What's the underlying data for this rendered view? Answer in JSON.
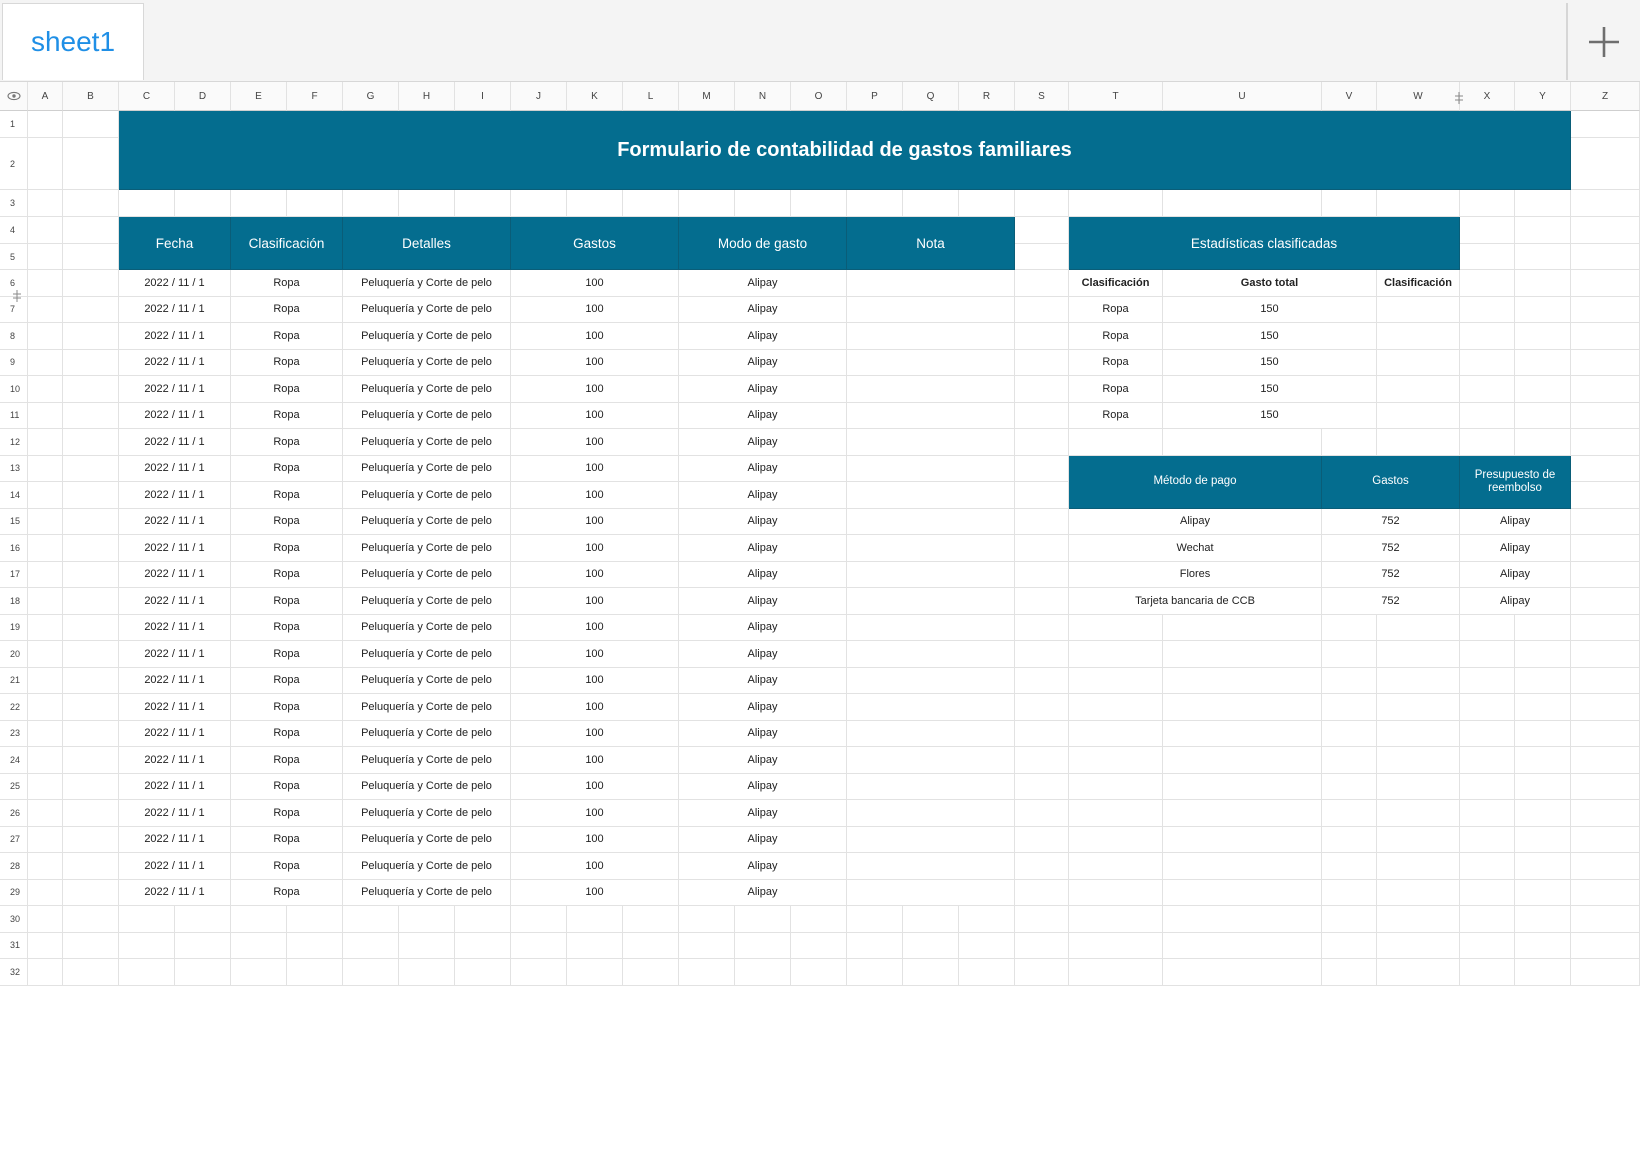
{
  "tabs": {
    "sheet_name": "sheet1"
  },
  "columns": [
    "A",
    "B",
    "C",
    "D",
    "E",
    "F",
    "G",
    "H",
    "I",
    "J",
    "K",
    "L",
    "M",
    "N",
    "O",
    "P",
    "Q",
    "R",
    "S",
    "T",
    "U",
    "V",
    "W",
    "X",
    "Y",
    "Z"
  ],
  "rows": [
    "1",
    "2",
    "3",
    "4",
    "5",
    "6",
    "7",
    "8",
    "9",
    "10",
    "11",
    "12",
    "13",
    "14",
    "15",
    "16",
    "17",
    "18",
    "19",
    "20",
    "21",
    "22",
    "23",
    "24",
    "25",
    "26",
    "27",
    "28",
    "29",
    "30",
    "31",
    "32"
  ],
  "title": "Formulario de contabilidad de gastos familiares",
  "main_table": {
    "headers": [
      "Fecha",
      "Clasificación",
      "Detalles",
      "Gastos",
      "Modo de gasto",
      "Nota"
    ],
    "rows": [
      {
        "fecha": "2022 / 11 / 1",
        "clasificacion": "Ropa",
        "detalles": "Peluquería y Corte de pelo",
        "gastos": "100",
        "modo": "Alipay",
        "nota": ""
      },
      {
        "fecha": "2022 / 11 / 1",
        "clasificacion": "Ropa",
        "detalles": "Peluquería y Corte de pelo",
        "gastos": "100",
        "modo": "Alipay",
        "nota": ""
      },
      {
        "fecha": "2022 / 11 / 1",
        "clasificacion": "Ropa",
        "detalles": "Peluquería y Corte de pelo",
        "gastos": "100",
        "modo": "Alipay",
        "nota": ""
      },
      {
        "fecha": "2022 / 11 / 1",
        "clasificacion": "Ropa",
        "detalles": "Peluquería y Corte de pelo",
        "gastos": "100",
        "modo": "Alipay",
        "nota": ""
      },
      {
        "fecha": "2022 / 11 / 1",
        "clasificacion": "Ropa",
        "detalles": "Peluquería y Corte de pelo",
        "gastos": "100",
        "modo": "Alipay",
        "nota": ""
      },
      {
        "fecha": "2022 / 11 / 1",
        "clasificacion": "Ropa",
        "detalles": "Peluquería y Corte de pelo",
        "gastos": "100",
        "modo": "Alipay",
        "nota": ""
      },
      {
        "fecha": "2022 / 11 / 1",
        "clasificacion": "Ropa",
        "detalles": "Peluquería y Corte de pelo",
        "gastos": "100",
        "modo": "Alipay",
        "nota": ""
      },
      {
        "fecha": "2022 / 11 / 1",
        "clasificacion": "Ropa",
        "detalles": "Peluquería y Corte de pelo",
        "gastos": "100",
        "modo": "Alipay",
        "nota": ""
      },
      {
        "fecha": "2022 / 11 / 1",
        "clasificacion": "Ropa",
        "detalles": "Peluquería y Corte de pelo",
        "gastos": "100",
        "modo": "Alipay",
        "nota": ""
      },
      {
        "fecha": "2022 / 11 / 1",
        "clasificacion": "Ropa",
        "detalles": "Peluquería y Corte de pelo",
        "gastos": "100",
        "modo": "Alipay",
        "nota": ""
      },
      {
        "fecha": "2022 / 11 / 1",
        "clasificacion": "Ropa",
        "detalles": "Peluquería y Corte de pelo",
        "gastos": "100",
        "modo": "Alipay",
        "nota": ""
      },
      {
        "fecha": "2022 / 11 / 1",
        "clasificacion": "Ropa",
        "detalles": "Peluquería y Corte de pelo",
        "gastos": "100",
        "modo": "Alipay",
        "nota": ""
      },
      {
        "fecha": "2022 / 11 / 1",
        "clasificacion": "Ropa",
        "detalles": "Peluquería y Corte de pelo",
        "gastos": "100",
        "modo": "Alipay",
        "nota": ""
      },
      {
        "fecha": "2022 / 11 / 1",
        "clasificacion": "Ropa",
        "detalles": "Peluquería y Corte de pelo",
        "gastos": "100",
        "modo": "Alipay",
        "nota": ""
      },
      {
        "fecha": "2022 / 11 / 1",
        "clasificacion": "Ropa",
        "detalles": "Peluquería y Corte de pelo",
        "gastos": "100",
        "modo": "Alipay",
        "nota": ""
      },
      {
        "fecha": "2022 / 11 / 1",
        "clasificacion": "Ropa",
        "detalles": "Peluquería y Corte de pelo",
        "gastos": "100",
        "modo": "Alipay",
        "nota": ""
      },
      {
        "fecha": "2022 / 11 / 1",
        "clasificacion": "Ropa",
        "detalles": "Peluquería y Corte de pelo",
        "gastos": "100",
        "modo": "Alipay",
        "nota": ""
      },
      {
        "fecha": "2022 / 11 / 1",
        "clasificacion": "Ropa",
        "detalles": "Peluquería y Corte de pelo",
        "gastos": "100",
        "modo": "Alipay",
        "nota": ""
      },
      {
        "fecha": "2022 / 11 / 1",
        "clasificacion": "Ropa",
        "detalles": "Peluquería y Corte de pelo",
        "gastos": "100",
        "modo": "Alipay",
        "nota": ""
      },
      {
        "fecha": "2022 / 11 / 1",
        "clasificacion": "Ropa",
        "detalles": "Peluquería y Corte de pelo",
        "gastos": "100",
        "modo": "Alipay",
        "nota": ""
      },
      {
        "fecha": "2022 / 11 / 1",
        "clasificacion": "Ropa",
        "detalles": "Peluquería y Corte de pelo",
        "gastos": "100",
        "modo": "Alipay",
        "nota": ""
      },
      {
        "fecha": "2022 / 11 / 1",
        "clasificacion": "Ropa",
        "detalles": "Peluquería y Corte de pelo",
        "gastos": "100",
        "modo": "Alipay",
        "nota": ""
      },
      {
        "fecha": "2022 / 11 / 1",
        "clasificacion": "Ropa",
        "detalles": "Peluquería y Corte de pelo",
        "gastos": "100",
        "modo": "Alipay",
        "nota": ""
      },
      {
        "fecha": "2022 / 11 / 1",
        "clasificacion": "Ropa",
        "detalles": "Peluquería y Corte de pelo",
        "gastos": "100",
        "modo": "Alipay",
        "nota": ""
      }
    ]
  },
  "stats_table": {
    "title": "Estadísticas clasificadas",
    "headers": [
      "Clasificación",
      "Gasto total",
      "Clasificación"
    ],
    "rows": [
      {
        "clasificacion": "Ropa",
        "gasto_total": "150",
        "extra": ""
      },
      {
        "clasificacion": "Ropa",
        "gasto_total": "150",
        "extra": ""
      },
      {
        "clasificacion": "Ropa",
        "gasto_total": "150",
        "extra": ""
      },
      {
        "clasificacion": "Ropa",
        "gasto_total": "150",
        "extra": ""
      },
      {
        "clasificacion": "Ropa",
        "gasto_total": "150",
        "extra": ""
      }
    ]
  },
  "payment_table": {
    "headers": [
      "Método de pago",
      "Gastos",
      "Presupuesto de reembolso"
    ],
    "rows": [
      {
        "metodo": "Alipay",
        "gastos": "752",
        "presupuesto": "Alipay"
      },
      {
        "metodo": "Wechat",
        "gastos": "752",
        "presupuesto": "Alipay"
      },
      {
        "metodo": "Flores",
        "gastos": "752",
        "presupuesto": "Alipay"
      },
      {
        "metodo": "Tarjeta bancaria de CCB",
        "gastos": "752",
        "presupuesto": "Alipay"
      }
    ]
  },
  "colors": {
    "accent": "#046d8f",
    "tab_text": "#1f8fe6",
    "grid_line": "#e2e2e2"
  },
  "icons": {
    "add_sheet": "plus-icon",
    "visibility": "eye-icon",
    "resize_handle": "resize-handle-icon"
  }
}
